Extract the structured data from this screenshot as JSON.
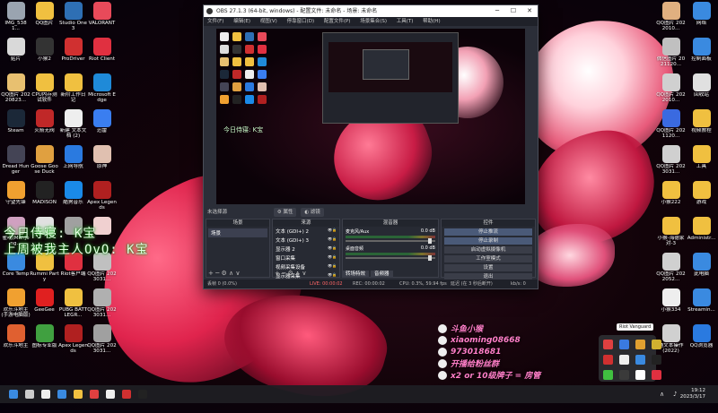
{
  "desktop_left": [
    {
      "label": "IMG_5381...",
      "color": "#9aa4b0"
    },
    {
      "label": "QQ图片",
      "color": "#f0c040"
    },
    {
      "label": "Studio One 3",
      "color": "#2e6fb4"
    },
    {
      "label": "VALORANT",
      "color": "#e84a5a"
    },
    {
      "label": "贴片",
      "color": "#d9d9d9"
    },
    {
      "label": "小猴2",
      "color": "#333"
    },
    {
      "label": "ProDriver",
      "color": "#d03030"
    },
    {
      "label": "Riot Client",
      "color": "#e03040"
    },
    {
      "label": "QQ图片 20220823...",
      "color": "#e8c070"
    },
    {
      "label": "CPU内存测试软件",
      "color": "#f0c040"
    },
    {
      "label": "新阶工作日记",
      "color": "#f0c040"
    },
    {
      "label": "Microsoft Edge",
      "color": "#1f8ad8"
    },
    {
      "label": "Steam",
      "color": "#1b2838"
    },
    {
      "label": "火箭无阀",
      "color": "#c02828"
    },
    {
      "label": "新建 文本文档 (2)",
      "color": "#eeeeee"
    },
    {
      "label": "迅雷",
      "color": "#3a7ef0"
    },
    {
      "label": "Dread Hunger",
      "color": "#445"
    },
    {
      "label": "Goose Goose Duck",
      "color": "#e0a040"
    },
    {
      "label": "上网导航",
      "color": "#2a7ae0"
    },
    {
      "label": "原神",
      "color": "#e0c0b0"
    },
    {
      "label": "守望先锋",
      "color": "#f0a030"
    },
    {
      "label": "MADISON",
      "color": "#222"
    },
    {
      "label": "酷狗音乐",
      "color": "#1a8ae8"
    },
    {
      "label": "Apex Legends",
      "color": "#b02020"
    },
    {
      "label": "雀魂(Mahjong...",
      "color": "#d0a0c0"
    },
    {
      "label": "",
      "color": "#e0e0e0"
    },
    {
      "label": "",
      "color": "#a0a0a0"
    },
    {
      "label": "",
      "color": "#f0d0d0"
    },
    {
      "label": "Core Temp",
      "color": "#3a8ae0"
    },
    {
      "label": "Rummi Party",
      "color": "#f0c040"
    },
    {
      "label": "Riot客户端",
      "color": "#e03040"
    },
    {
      "label": "QQ图片 2023031...",
      "color": "#c0c0c0"
    },
    {
      "label": "欢乐斗地主(手游电脑版)",
      "color": "#f0a030"
    },
    {
      "label": "GeeGee",
      "color": "#e02020"
    },
    {
      "label": "PUBG BATTLEGR...",
      "color": "#f0c040"
    },
    {
      "label": "QQ图片 2023031...",
      "color": "#b0b0b0"
    },
    {
      "label": "欢乐斗地主",
      "color": "#e06030"
    },
    {
      "label": "图标专业版",
      "color": "#40a040"
    },
    {
      "label": "Apex Legends",
      "color": "#b02020"
    },
    {
      "label": "QQ图片 2023031...",
      "color": "#a0a0a0"
    }
  ],
  "desktop_right": [
    {
      "label": "QQ图片 2022010...",
      "color": "#e0b080"
    },
    {
      "label": "网络",
      "color": "#3a8ae0"
    },
    {
      "label": "微信图片 2021120...",
      "color": "#c0c0c0"
    },
    {
      "label": "控制面板",
      "color": "#3a8ae0"
    },
    {
      "label": "QQ图片 2022010...",
      "color": "#d0d0d0"
    },
    {
      "label": "回收站",
      "color": "#e0e0e0"
    },
    {
      "label": "QQ图片 2021120...",
      "color": "#3a6ae0"
    },
    {
      "label": "视频教程",
      "color": "#f0c040"
    },
    {
      "label": "QQ图片 2023031...",
      "color": "#d0d0d0"
    },
    {
      "label": "工具",
      "color": "#f0c040"
    },
    {
      "label": "小猴222",
      "color": "#f0c040"
    },
    {
      "label": "游戏",
      "color": "#f0c040"
    },
    {
      "label": "小猴-海德家对-3",
      "color": "#f0c040"
    },
    {
      "label": "Administr...",
      "color": "#f0c040"
    },
    {
      "label": "QQ图片 2022052...",
      "color": "#d0d0d0"
    },
    {
      "label": "此电脑",
      "color": "#3a8ae0"
    },
    {
      "label": "小猴334",
      "color": "#eee"
    },
    {
      "label": "Streamin...",
      "color": "#3a8ae0"
    },
    {
      "label": "通文本操作(2022)",
      "color": "#d0d0d0"
    },
    {
      "label": "QQ浏览器",
      "color": "#2a7ae0"
    }
  ],
  "overlay_line1": "今日侍寝: K宝",
  "overlay_line2": "上周被我主人OvO: K宝",
  "obs": {
    "title": "OBS 27.1.3 (64-bit, windows) - 配置文件: 未命名 - 场景: 未命名",
    "menu": [
      "文件(F)",
      "编辑(E)",
      "视图(V)",
      "停靠窗口(D)",
      "配置文件(P)",
      "场景集合(S)",
      "工具(T)",
      "帮助(H)"
    ],
    "min": "─",
    "max": "☐",
    "close": "✕",
    "preview_text": "今日侍寝: K宝",
    "no_source": "未选择源",
    "properties": "⚙ 属性",
    "filters": "◐ 滤镜",
    "dock_scenes": "场景",
    "dock_sources": "来源",
    "dock_mixer": "混音器",
    "dock_controls": "控件",
    "scene_items": [
      "场景"
    ],
    "source_items": [
      "文本 (GDI+) 2",
      "文本 (GDI+) 3",
      "显示器 2",
      "窗口采集",
      "视频采集设备",
      "显示器采集"
    ],
    "mixer": [
      {
        "name": "麦克风/Aux",
        "db": "0.0 dB"
      },
      {
        "name": "桌面音频",
        "db": "0.0 dB"
      }
    ],
    "controls": [
      "停止推流",
      "停止录制",
      "启动虚拟摄像机",
      "工作室模式",
      "设置",
      "退出"
    ],
    "tabs": [
      "转场特效",
      "音频器"
    ],
    "footer_add": "+ ─ ⚙ ∧ ∨",
    "status": {
      "dropped": "丢帧 0 (0.0%)",
      "live": "LIVE: 00:00:02",
      "rec": "REC: 00:00:02",
      "cpu": "CPU: 0.3%, 59.94 fps",
      "delay": "延迟 (在 3 秒后断开)",
      "kbps": "kb/s: 0"
    }
  },
  "streamer": {
    "line1": "斗鱼小猴",
    "line2": "xiaoming08668",
    "line3": "973018681",
    "line4": "开播给粉丝群",
    "line5": "x2 or 10级牌子 = 房管"
  },
  "tray_tooltip": "Riot Vanguard",
  "tray_icons": [
    "#e04040",
    "#3a7ae0",
    "#e0a030",
    "#d0b030",
    "#d03030",
    "#eeeeee",
    "#3a8ae0",
    "#222222",
    "#40c040",
    "#3a3a3a",
    "#ffffff",
    "#e03040"
  ],
  "taskbar": {
    "time": "19:12",
    "date": "2023/3/17",
    "icons": [
      "#3a8ae0",
      "#cccccc",
      "#eeeeee",
      "#3a8ae0",
      "#f0c040",
      "#e04040",
      "#eeeeee",
      "#d03030",
      "#222"
    ]
  }
}
